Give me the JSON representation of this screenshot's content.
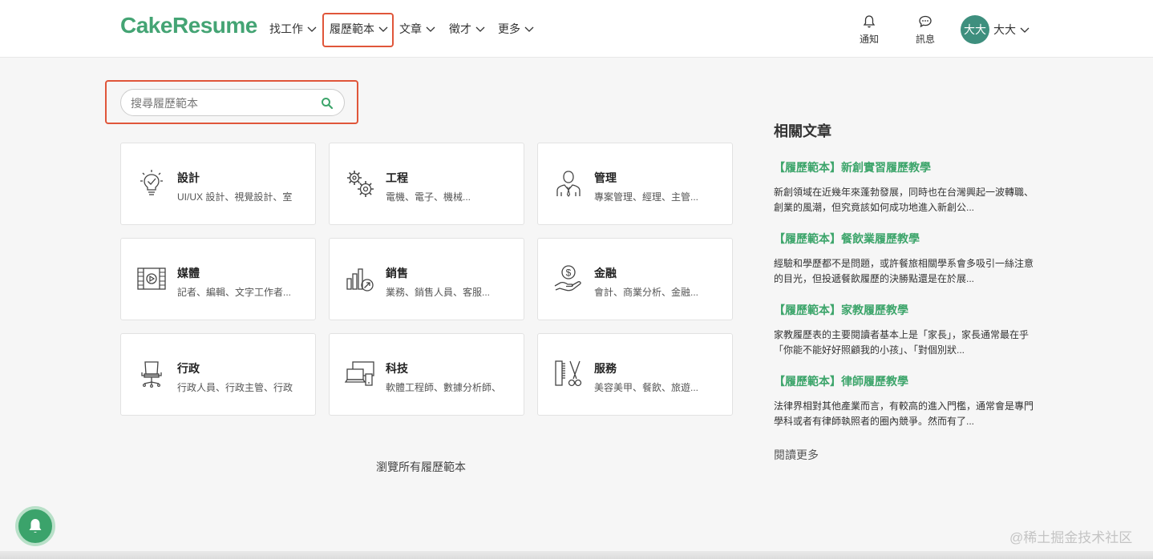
{
  "header": {
    "logo": "CakeResume",
    "nav": [
      {
        "label": "找工作"
      },
      {
        "label": "履歷範本"
      },
      {
        "label": "文章"
      },
      {
        "label": "徵才"
      },
      {
        "label": "更多"
      }
    ],
    "notifications_label": "通知",
    "messages_label": "訊息",
    "avatar_text": "大大",
    "user_name": "大大"
  },
  "search": {
    "placeholder": "搜尋履歷範本"
  },
  "categories": [
    {
      "title": "設計",
      "subtitle": "UI/UX 設計、視覺設計、室",
      "icon": "lightbulb-icon"
    },
    {
      "title": "工程",
      "subtitle": "電機、電子、機械...",
      "icon": "gears-icon"
    },
    {
      "title": "管理",
      "subtitle": "專案管理、經理、主管...",
      "icon": "manager-icon"
    },
    {
      "title": "媒體",
      "subtitle": "記者、編輯、文字工作者...",
      "icon": "film-icon"
    },
    {
      "title": "銷售",
      "subtitle": "業務、銷售人員、客服...",
      "icon": "chart-growth-icon"
    },
    {
      "title": "金融",
      "subtitle": "會計、商業分析、金融...",
      "icon": "money-hand-icon"
    },
    {
      "title": "行政",
      "subtitle": "行政人員、行政主管、行政",
      "icon": "office-chair-icon"
    },
    {
      "title": "科技",
      "subtitle": "軟體工程師、數據分析師、",
      "icon": "devices-icon"
    },
    {
      "title": "服務",
      "subtitle": "美容美甲、餐飲、旅遊...",
      "icon": "comb-scissors-icon"
    }
  ],
  "browse_all": "瀏覽所有履歷範本",
  "related": {
    "title": "相關文章",
    "articles": [
      {
        "title": "【履歷範本】新創實習履歷教學",
        "desc": "新創領域在近幾年來蓬勃發展，同時也在台灣興起一波轉職、創業的風潮，但究竟該如何成功地進入新創公..."
      },
      {
        "title": "【履歷範本】餐飲業履歷教學",
        "desc": "經驗和學歷都不是問題，或許餐旅相關學系會多吸引一絲注意的目光，但投遞餐飲履歷的決勝點還是在於展..."
      },
      {
        "title": "【履歷範本】家教履歷教學",
        "desc": "家教履歷表的主要閱讀者基本上是「家長」，家長通常最在乎「你能不能好好照顧我的小孩」、「對個別狀..."
      },
      {
        "title": "【履歷範本】律師履歷教學",
        "desc": "法律界相對其他產業而言，有較高的進入門檻，通常會是專門學科或者有律師執照者的圈內競爭。然而有了..."
      }
    ],
    "read_more": "閱讀更多"
  },
  "watermark": "@稀土掘金技术社区",
  "colors": {
    "brand": "#44a474",
    "link": "#3da56b",
    "highlight": "#e0563a",
    "avatar": "#3e8f7e"
  }
}
